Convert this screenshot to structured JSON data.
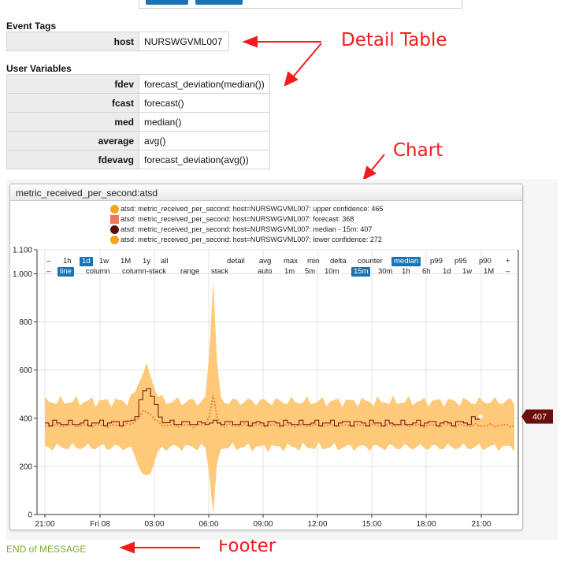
{
  "event_tags": {
    "title": "Event Tags",
    "rows": [
      {
        "key": "host",
        "value": "NURSWGVML007"
      }
    ]
  },
  "user_variables": {
    "title": "User Variables",
    "rows": [
      {
        "key": "fdev",
        "value": "forecast_deviation(median())"
      },
      {
        "key": "fcast",
        "value": "forecast()"
      },
      {
        "key": "med",
        "value": "median()"
      },
      {
        "key": "average",
        "value": "avg()"
      },
      {
        "key": "fdevavg",
        "value": "forecast_deviation(avg())"
      }
    ]
  },
  "annotations": {
    "detail_table": "Detail Table",
    "chart": "Chart",
    "footer": "Footer"
  },
  "widget": {
    "title": "metric_received_per_second:atsd",
    "legend": [
      {
        "label": "atsd: metric_received_per_second: host=NURSWGVML007: upper confidence: 465",
        "color": "#f7a21c",
        "shape": "circle"
      },
      {
        "label": "atsd: metric_received_per_second: host=NURSWGVML007: forecast: 368",
        "color": "#f5735a",
        "shape": "square"
      },
      {
        "label": "atsd: metric_received_per_second: host=NURSWGVML007: median - 15m: 407",
        "color": "#5a0f0f",
        "shape": "circle"
      },
      {
        "label": "atsd: metric_received_per_second: host=NURSWGVML007: lower confidence: 272",
        "color": "#f7a21c",
        "shape": "circle"
      }
    ],
    "controls_row1": [
      "–",
      "1h",
      "1d",
      "1w",
      "1M",
      "1y",
      "all",
      "detail",
      "avg",
      "max",
      "min",
      "delta",
      "counter",
      "median",
      "p99",
      "p95",
      "p90",
      "+"
    ],
    "controls_row1_active": [
      "1d",
      "median"
    ],
    "controls_row2": [
      "–",
      "line",
      "column",
      "column-stack",
      "range",
      "stack",
      "auto",
      "1m",
      "5m",
      "10m",
      "15m",
      "30m",
      "1h",
      "6h",
      "1d",
      "1w",
      "1M",
      "–"
    ],
    "controls_row2_active": [
      "line",
      "15m"
    ],
    "last_value_badge": "407"
  },
  "colors": {
    "band": "#fec979",
    "median_line": "#6b0d0d",
    "forecast_line": "#f0824a",
    "badge": "#6b0d0d",
    "active_control": "#1a73b5",
    "footer_text": "#7cae2a",
    "annotation": "#f21b1b"
  },
  "chart_data": {
    "type": "line",
    "title": "metric_received_per_second:atsd",
    "ylim": [
      0,
      1100
    ],
    "yticks": [
      "0",
      "200",
      "400",
      "600",
      "800",
      "1.000",
      "1.100"
    ],
    "xtick_labels": [
      "21:00",
      "Fri 08",
      "03:00",
      "06:00",
      "09:00",
      "12:00",
      "15:00",
      "18:00",
      "21:00"
    ],
    "x": [
      "21:00",
      "Fri 08",
      "03:00",
      "06:00",
      "09:00",
      "12:00",
      "15:00",
      "18:00",
      "21:00"
    ],
    "series": [
      {
        "name": "upper confidence",
        "values": [
          480,
          490,
          600,
          1000,
          470,
          475,
          470,
          465,
          465
        ]
      },
      {
        "name": "forecast",
        "values": [
          370,
          370,
          440,
          500,
          375,
          365,
          365,
          370,
          368
        ]
      },
      {
        "name": "median - 15m",
        "values": [
          380,
          385,
          530,
          380,
          385,
          385,
          380,
          395,
          407
        ]
      },
      {
        "name": "lower confidence",
        "values": [
          280,
          270,
          150,
          0,
          265,
          270,
          275,
          280,
          272
        ]
      }
    ],
    "grid": true
  },
  "footer": {
    "text": "END of MESSAGE"
  }
}
